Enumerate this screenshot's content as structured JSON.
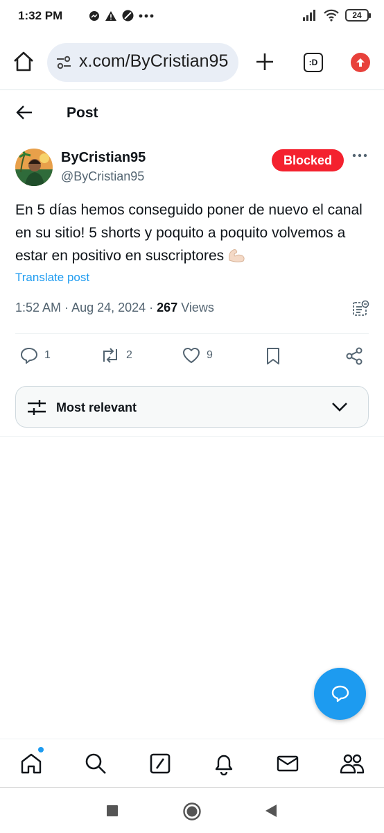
{
  "status_bar": {
    "time": "1:32 PM",
    "battery": "24",
    "icons": [
      "messenger-icon",
      "warning-icon",
      "dnd-icon",
      "more-dots-icon",
      "signal-icon",
      "wifi-icon"
    ]
  },
  "browser": {
    "url": "x.com/ByCristian95",
    "tab_count": ":D"
  },
  "header": {
    "title": "Post"
  },
  "post": {
    "display_name": "ByCristian95",
    "handle": "@ByCristian95",
    "badge": "Blocked",
    "text": "En 5 días hemos conseguido poner de nuevo el canal en su sitio! 5 shorts y poquito a poquito volvemos a estar en positivo en suscriptores",
    "emoji": "flexed-biceps",
    "translate": "Translate post",
    "time": "1:52 AM",
    "date": "Aug 24, 2024",
    "views_count": "267",
    "views_label": "Views"
  },
  "actions": {
    "replies": "1",
    "reposts": "2",
    "likes": "9"
  },
  "sort": {
    "label": "Most relevant"
  },
  "colors": {
    "accent": "#1d9bf0",
    "blocked": "#f4212e",
    "text": "#0f1419",
    "secondary": "#536471"
  }
}
